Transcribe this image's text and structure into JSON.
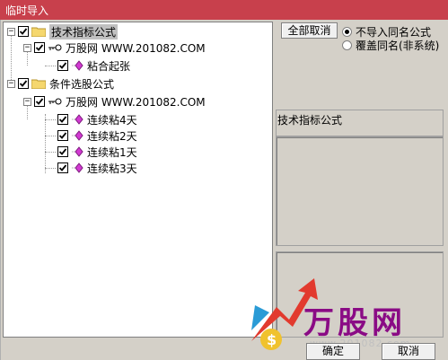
{
  "window": {
    "title": "临时导入"
  },
  "tree": {
    "nodes": [
      {
        "label": "技术指标公式",
        "checked": true
      },
      {
        "label": "万股网 WWW.201082.COM",
        "checked": true
      },
      {
        "label": "粘合起张",
        "checked": true
      },
      {
        "label": "条件选股公式",
        "checked": true
      },
      {
        "label": "万股网 WWW.201082.COM",
        "checked": true
      },
      {
        "label": "连续粘4天",
        "checked": true
      },
      {
        "label": "连续粘2天",
        "checked": true
      },
      {
        "label": "连续粘1天",
        "checked": true
      },
      {
        "label": "连续粘3天",
        "checked": true
      }
    ]
  },
  "controls": {
    "cancel_all_label": "全部取消",
    "radio_no_import": "不导入同名公式",
    "radio_overwrite": "覆盖同名(非系统)",
    "selected_radio": "radio_no_import"
  },
  "info": {
    "type_label": "技术指标公式"
  },
  "buttons": {
    "ok": "确定",
    "cancel": "取消"
  },
  "watermark": {
    "logo": "万股网",
    "url": "www.201082.com"
  }
}
